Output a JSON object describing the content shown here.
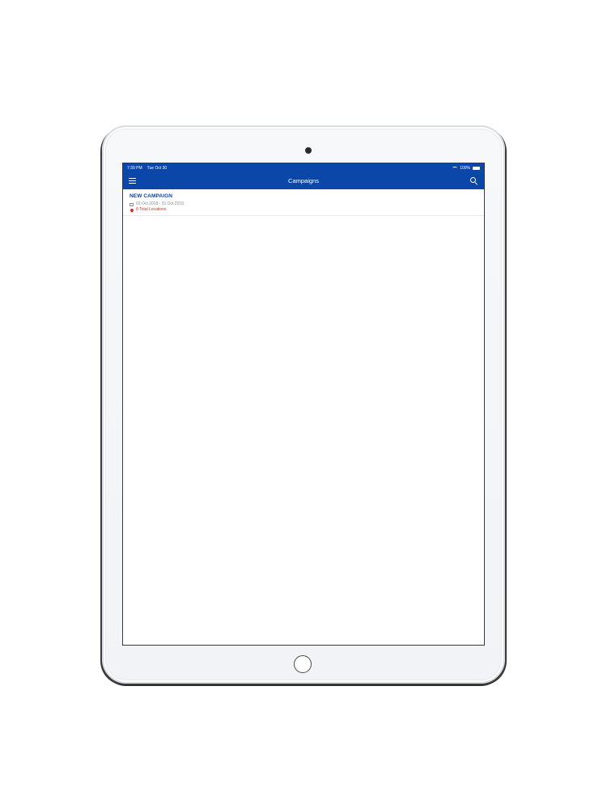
{
  "status_bar": {
    "time": "7:39 PM",
    "date": "Tue Oct 30",
    "battery": "100%"
  },
  "nav": {
    "title": "Campaigns"
  },
  "campaigns": [
    {
      "name": "NEW CAMPAIGN",
      "date_range": "03.Oct.2018 - 31.Oct.2018",
      "locations": "0 Total Locations"
    }
  ],
  "colors": {
    "primary": "#0a47a9",
    "location_text": "#e02b2b"
  },
  "icons": [
    "menu-icon",
    "search-icon",
    "calendar-icon",
    "location-pin-icon",
    "wifi-icon",
    "battery-icon"
  ]
}
